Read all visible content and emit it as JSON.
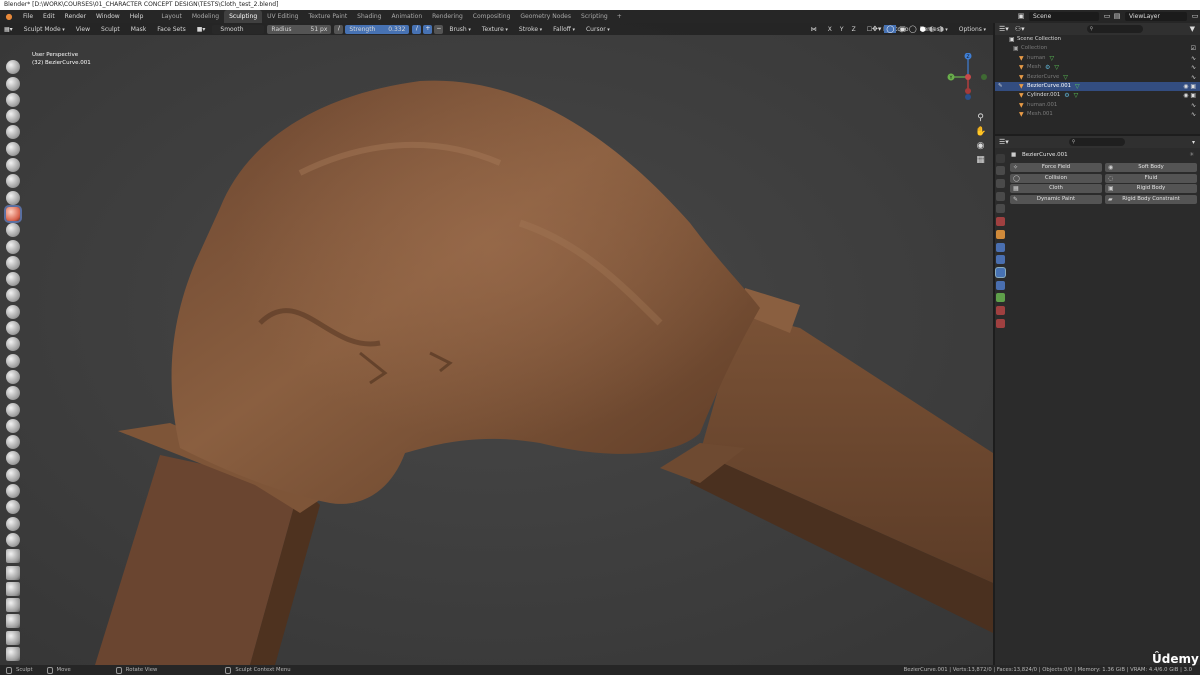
{
  "title_bar": {
    "text": "Blender* [D:\\WORK\\COURSES\\01_CHARACTER CONCEPT DESIGN\\TESTS\\Cloth_test_2.blend]"
  },
  "menu": {
    "items": [
      "File",
      "Edit",
      "Render",
      "Window",
      "Help"
    ]
  },
  "workspaces": {
    "tabs": [
      "Layout",
      "Modeling",
      "Sculpting",
      "UV Editing",
      "Texture Paint",
      "Shading",
      "Animation",
      "Rendering",
      "Compositing",
      "Geometry Nodes",
      "Scripting"
    ],
    "active": "Sculpting"
  },
  "top_right": {
    "scene": "Scene",
    "view_layer": "ViewLayer"
  },
  "viewport_header": {
    "mode": "Sculpt Mode",
    "menus": [
      "View",
      "Sculpt",
      "Mask",
      "Face Sets"
    ],
    "brush_name": "Smooth",
    "radius_label": "Radius",
    "radius_value": "51 px",
    "strength_label": "Strength",
    "strength_value": "0.332",
    "dropdowns": [
      "Brush",
      "Texture",
      "Stroke",
      "Falloff",
      "Cursor"
    ],
    "axes": [
      "X",
      "Y",
      "Z"
    ],
    "right_menus": [
      "Dyntopo",
      "Remesh",
      "Options"
    ]
  },
  "viewport_info": {
    "perspective": "User Perspective",
    "object": "(32) BezierCurve.001"
  },
  "gizmo_axes": {
    "x": "X",
    "y": "Y",
    "z": "Z",
    "x_color": "#d04040",
    "y_color": "#6ab04c",
    "z_color": "#3f7fd6"
  },
  "outliner": {
    "search_placeholder": "",
    "rows": [
      {
        "name": "Scene Collection",
        "dim": false,
        "selected": false
      },
      {
        "name": "Collection",
        "dim": true,
        "selected": false
      },
      {
        "name": "human",
        "dim": true,
        "selected": false
      },
      {
        "name": "Mesh",
        "dim": true,
        "selected": false
      },
      {
        "name": "BezierCurve",
        "dim": true,
        "selected": false
      },
      {
        "name": "BezierCurve.001",
        "dim": false,
        "selected": true
      },
      {
        "name": "Cylinder.001",
        "dim": false,
        "selected": false
      },
      {
        "name": "human.001",
        "dim": true,
        "selected": false
      },
      {
        "name": "Mesh.001",
        "dim": true,
        "selected": false
      }
    ]
  },
  "properties": {
    "object_name": "BezierCurve.001",
    "physics_buttons": [
      {
        "label": "Force Field",
        "icon": "force-field-icon"
      },
      {
        "label": "Soft Body",
        "icon": "soft-body-icon"
      },
      {
        "label": "Collision",
        "icon": "collision-icon"
      },
      {
        "label": "Fluid",
        "icon": "fluid-icon"
      },
      {
        "label": "Cloth",
        "icon": "cloth-icon"
      },
      {
        "label": "Rigid Body",
        "icon": "rigid-body-icon"
      },
      {
        "label": "Dynamic Paint",
        "icon": "dynamic-paint-icon"
      },
      {
        "label": "Rigid Body Constraint",
        "icon": "rigid-body-constraint-icon"
      }
    ]
  },
  "status_bar": {
    "left": [
      "Sculpt",
      "Move",
      "Rotate View",
      "Sculpt Context Menu"
    ],
    "stats": "BezierCurve.001 | Verts:13,872/0 | Faces:13,824/0 | Objects:0/0 | Memory: 1.36 GiB | VRAM: 4.4/6.0 GiB | 3.0"
  },
  "watermark": "Ûdemy",
  "colors": {
    "accent": "#4772b3",
    "selected_row": "#334d80",
    "cloth": "#7a5236",
    "background": "#3e3e3e"
  }
}
